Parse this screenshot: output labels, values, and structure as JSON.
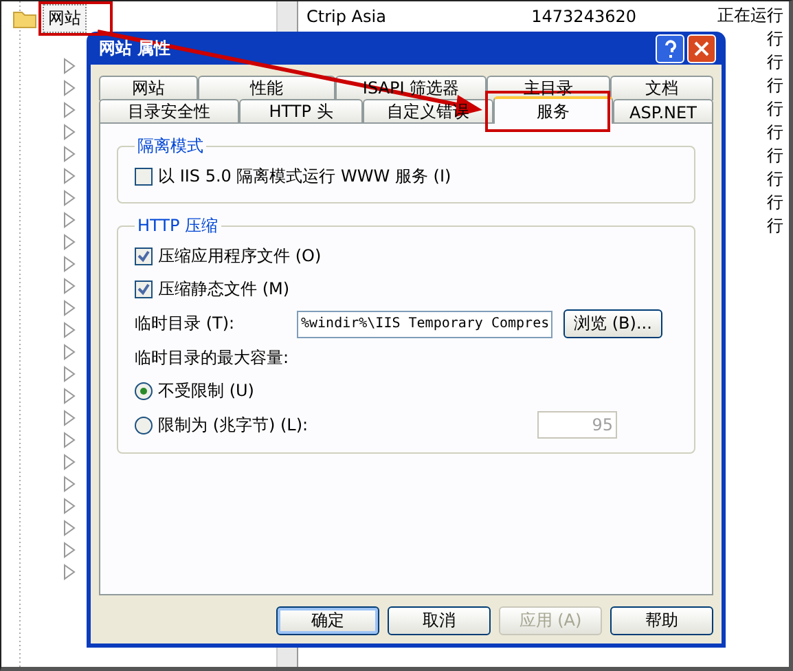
{
  "tree": {
    "root": {
      "label": "网站"
    }
  },
  "site_list": {
    "rows": [
      {
        "name": "Ctrip Asia",
        "id": "1473243620",
        "status": "正在运行"
      },
      {
        "status": "行"
      },
      {
        "status": "行"
      },
      {
        "status": "行"
      },
      {
        "status": "行"
      },
      {
        "status": "行"
      },
      {
        "status": "行"
      },
      {
        "status": "行"
      },
      {
        "status": "行"
      },
      {
        "status": "行"
      }
    ]
  },
  "dialog": {
    "title": "网站 属性",
    "tab_rows": [
      [
        {
          "label": "网站",
          "selected": false
        },
        {
          "label": "性能",
          "selected": false
        },
        {
          "label": "ISAPI 筛选器",
          "selected": false
        },
        {
          "label": "主目录",
          "selected": false
        },
        {
          "label": "文档",
          "selected": false
        }
      ],
      [
        {
          "label": "目录安全性",
          "selected": false
        },
        {
          "label": "HTTP 头",
          "selected": false
        },
        {
          "label": "自定义错误",
          "selected": false
        },
        {
          "label": "服务",
          "selected": true
        },
        {
          "label": "ASP.NET",
          "selected": false
        }
      ]
    ],
    "isolation": {
      "title": "隔离模式",
      "checkbox": {
        "label": "以 IIS 5.0 隔离模式运行 WWW 服务 (I)",
        "checked": false
      }
    },
    "compression": {
      "title": "HTTP 压缩",
      "checkboxes": [
        {
          "label": "压缩应用程序文件 (O)",
          "checked": true
        },
        {
          "label": "压缩静态文件 (M)",
          "checked": true
        }
      ],
      "temp_dir": {
        "label": "临时目录 (T):",
        "value": "%windir%\\IIS Temporary Compres",
        "browse": "浏览 (B)..."
      },
      "max_size_label": "临时目录的最大容量:",
      "radios": [
        {
          "label": "不受限制 (U)",
          "selected": true
        },
        {
          "label": "限制为 (兆字节) (L):",
          "selected": false
        }
      ],
      "limit": {
        "value": "95",
        "disabled": true
      }
    },
    "buttons": [
      {
        "label": "确定",
        "default": true,
        "disabled": false
      },
      {
        "label": "取消",
        "default": false,
        "disabled": false
      },
      {
        "label": "应用 (A)",
        "default": false,
        "disabled": true
      },
      {
        "label": "帮助",
        "default": false,
        "disabled": false
      }
    ]
  }
}
